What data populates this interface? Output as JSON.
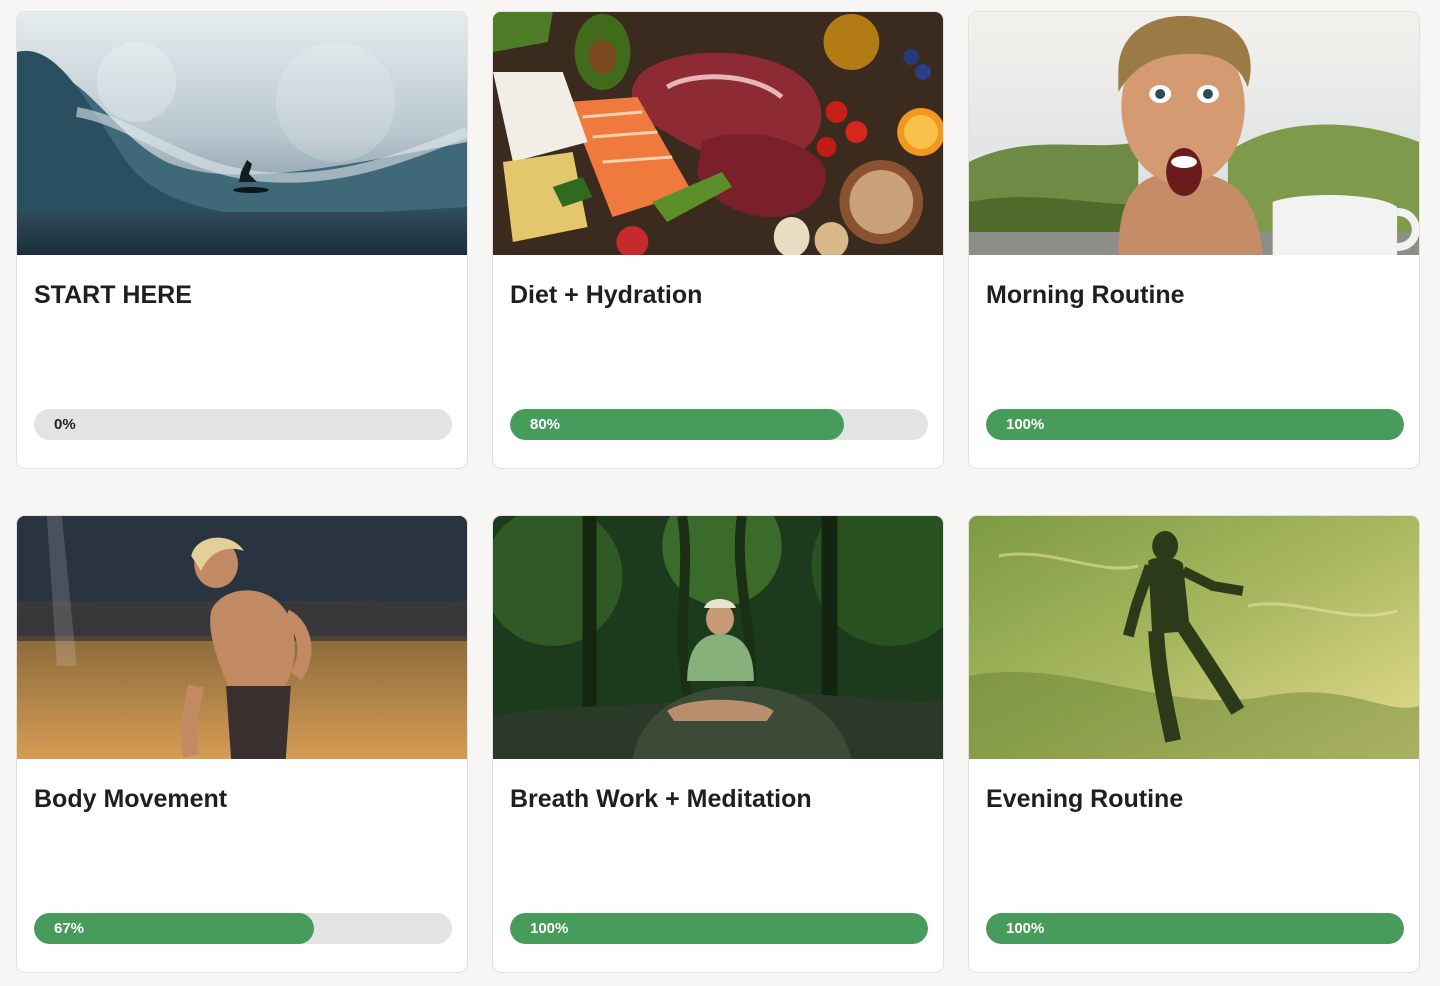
{
  "colors": {
    "page_bg": "#f7f6f5",
    "card_bg": "#ffffff",
    "progress_track": "#e3e3e3",
    "progress_fill": "#479b5b",
    "title_text": "#1f1f1f"
  },
  "courses": [
    {
      "title": "START HERE",
      "progress_label": "0%",
      "progress": 0,
      "image": "surfer-wave-photo"
    },
    {
      "title": "Diet + Hydration",
      "progress_label": "80%",
      "progress": 0.8,
      "image": "whole-foods-spread-photo"
    },
    {
      "title": "Morning Routine",
      "progress_label": "100%",
      "progress": 1.0,
      "image": "man-shocked-face-mountains-photo"
    },
    {
      "title": "Body Movement",
      "progress_label": "67%",
      "progress": 0.67,
      "image": "man-waterfall-pool-photo"
    },
    {
      "title": "Breath Work + Meditation",
      "progress_label": "100%",
      "progress": 1.0,
      "image": "man-meditating-jungle-photo"
    },
    {
      "title": "Evening Routine",
      "progress_label": "100%",
      "progress": 1.0,
      "image": "man-floating-underwater-photo"
    }
  ]
}
